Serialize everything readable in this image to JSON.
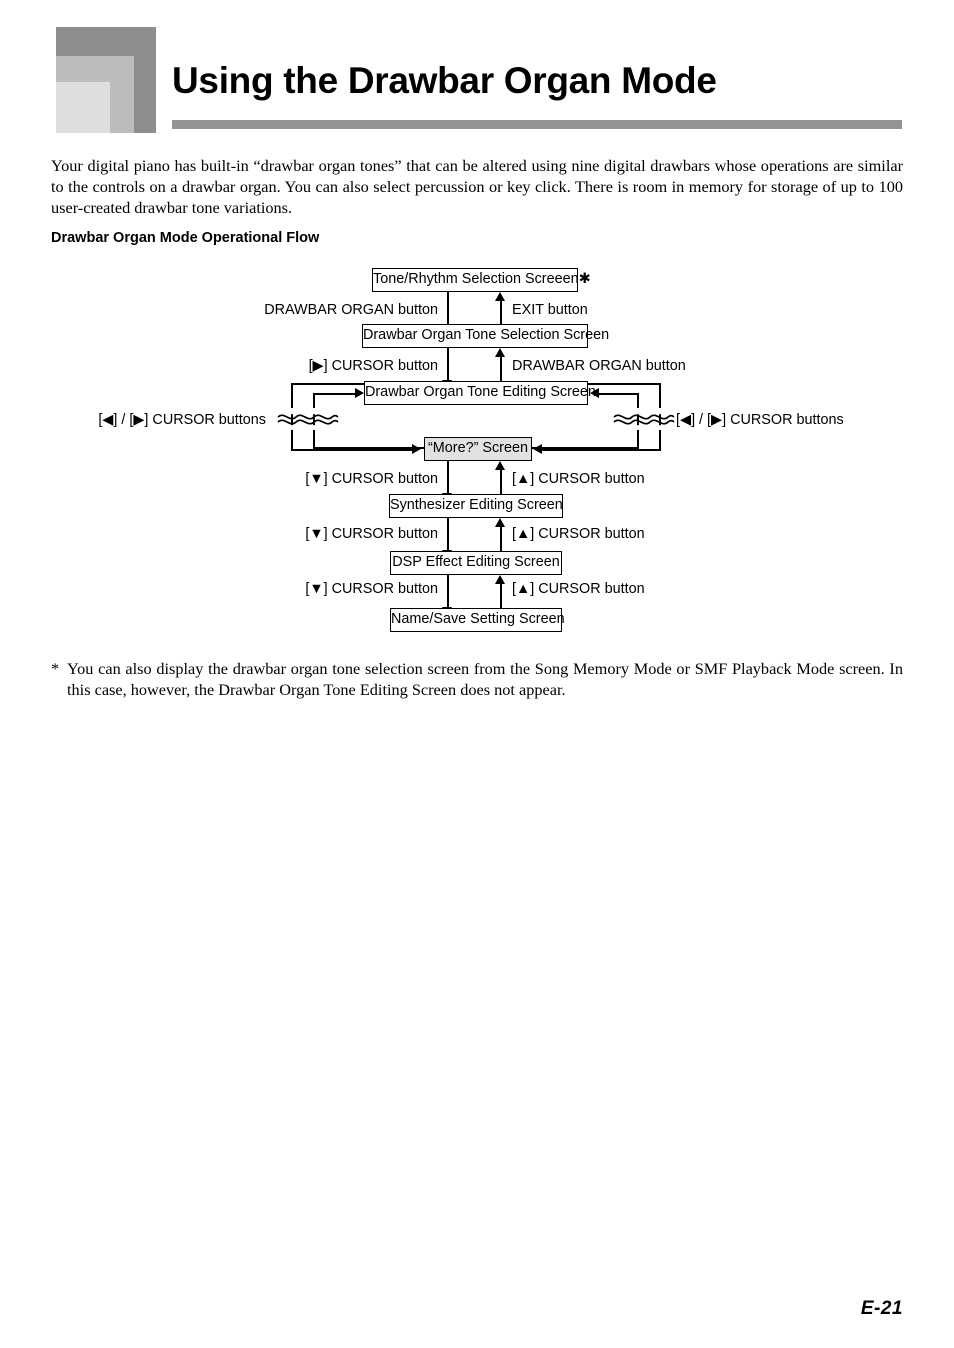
{
  "header": {
    "title": "Using the Drawbar Organ Mode",
    "decoration_icon": "nested-squares-icon",
    "rule_color": "#949494"
  },
  "intro": {
    "paragraph": "Your digital piano has built-in “drawbar organ tones” that can be altered using nine digital drawbars whose operations are similar to the controls on a drawbar organ. You can also select percussion or key click. There is room in memory for storage of up to 100 user-created drawbar tone variations."
  },
  "subheading": {
    "text": "Drawbar Organ Mode Operational Flow"
  },
  "flowchart": {
    "type": "flow-diagram",
    "boxes": {
      "tone_rhythm": "Tone/Rhythm Selection Screeen✱",
      "tone_selection": "Drawbar Organ Tone Selection Screen",
      "tone_editing": "Drawbar Organ Tone Editing Screen",
      "more": "“More?” Screen",
      "synth_editing": "Synthesizer Editing Screen",
      "dsp_editing": "DSP Effect Editing Screen",
      "name_save": "Name/Save Setting Screen"
    },
    "labels": {
      "drawbar_organ_button_1": "DRAWBAR ORGAN button",
      "exit_button": "EXIT button",
      "cursor_right_button": "[▶] CURSOR button",
      "drawbar_organ_button_2": "DRAWBAR ORGAN button",
      "cursor_lr_buttons_left": "[◀] / [▶] CURSOR buttons",
      "cursor_lr_buttons_right": "[◀] / [▶] CURSOR buttons",
      "cursor_down_1": "[▼] CURSOR button",
      "cursor_up_1": "[▲] CURSOR button",
      "cursor_down_2": "[▼] CURSOR button",
      "cursor_up_2": "[▲] CURSOR button",
      "cursor_down_3": "[▼] CURSOR button",
      "cursor_up_3": "[▲] CURSOR button"
    },
    "shaded_box_color": "#e2e2e2"
  },
  "footnote": {
    "marker": "*",
    "text": "You can also display the drawbar organ tone selection screen from the Song Memory Mode or SMF Playback Mode screen. In this case, however, the Drawbar Organ Tone Editing Screen does not appear."
  },
  "page_number": "E-21"
}
